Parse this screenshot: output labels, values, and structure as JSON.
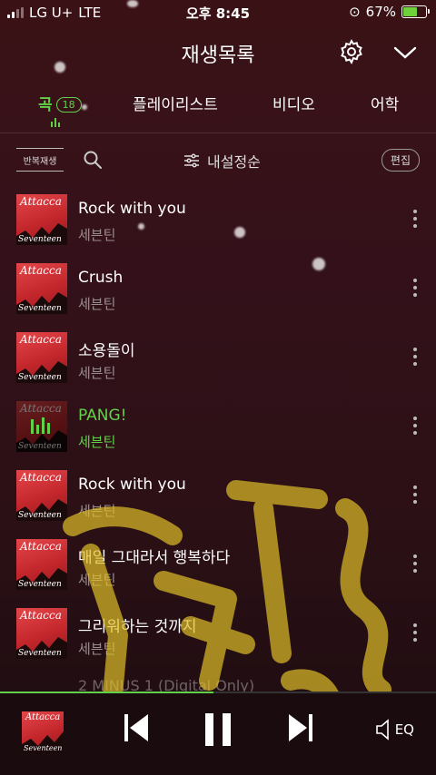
{
  "status": {
    "carrier": "LG U+",
    "network": "LTE",
    "time": "오후 8:45",
    "battery": "67%",
    "battery_level": 0.67
  },
  "header": {
    "title": "재생목록"
  },
  "tabs": [
    {
      "label": "곡",
      "badge": "18",
      "active": true
    },
    {
      "label": "플레이리스트"
    },
    {
      "label": "비디오"
    },
    {
      "label": "어학"
    }
  ],
  "toolbar": {
    "repeat": "반복재생",
    "sort": "내설정순",
    "edit": "편집"
  },
  "album_art": {
    "top": "Attacca",
    "bottom": "Seventeen"
  },
  "songs": [
    {
      "title": "Rock with you",
      "artist": "세븐틴"
    },
    {
      "title": "Crush",
      "artist": "세븐틴"
    },
    {
      "title": "소용돌이",
      "artist": "세븐틴"
    },
    {
      "title": "PANG!",
      "artist": "세븐틴",
      "playing": true
    },
    {
      "title": "Rock with you",
      "artist": "세븐틴"
    },
    {
      "title": "매일 그대라서 행복하다",
      "artist": "세븐틴"
    },
    {
      "title": "그리워하는 것까지",
      "artist": "세븐틴"
    }
  ],
  "partial_song": "2 MINUS 1 (Digital Only)",
  "player": {
    "eq_label": "EQ",
    "progress": 0.49
  },
  "colors": {
    "accent": "#62d14a",
    "background": "#34111a",
    "album": "#c2262b"
  }
}
